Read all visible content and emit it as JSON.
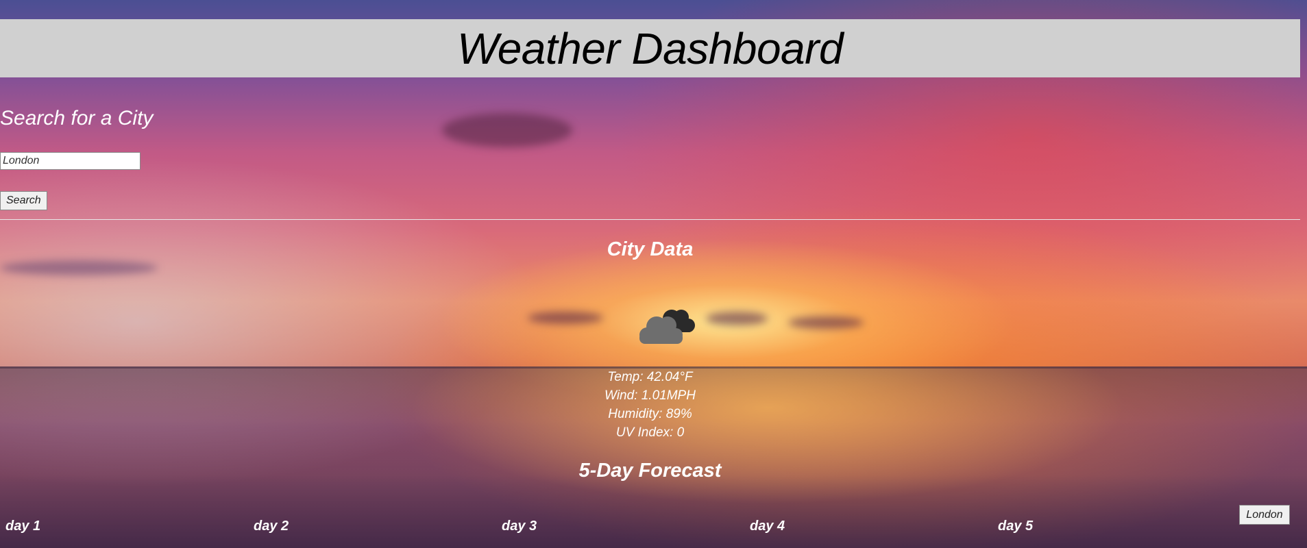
{
  "header": {
    "title": "Weather Dashboard"
  },
  "search": {
    "title": "Search for a City",
    "input_value": "London",
    "button_label": "Search"
  },
  "city": {
    "title": "City Data",
    "icon": "cloud-icon",
    "temp": "Temp: 42.04°F",
    "wind": "Wind: 1.01MPH",
    "humidity": "Humidity: 89%",
    "uv": "UV Index: 0"
  },
  "forecast": {
    "title": "5-Day Forecast",
    "days": [
      "day 1",
      "day 2",
      "day 3",
      "day 4",
      "day 5"
    ]
  },
  "history": {
    "items": [
      "London"
    ]
  }
}
